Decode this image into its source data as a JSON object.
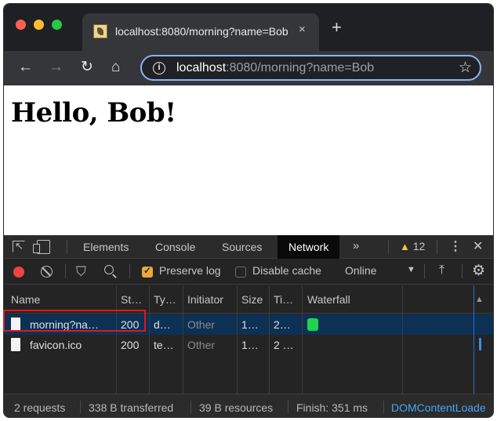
{
  "browser": {
    "tab": {
      "title": "localhost:8080/morning?name=Bob",
      "close_label": "×"
    },
    "new_tab_label": "+",
    "nav": {
      "back": "←",
      "forward": "→",
      "reload": "↻",
      "home": "⌂"
    },
    "url": {
      "host": "localhost",
      "rest": ":8080/morning?name=Bob"
    },
    "icons": {
      "info": "i",
      "star": "☆"
    }
  },
  "page": {
    "heading": "Hello, Bob!"
  },
  "devtools": {
    "tabs": [
      "Elements",
      "Console",
      "Sources",
      "Network"
    ],
    "active_tab": "Network",
    "more_tabs": "»",
    "warnings": {
      "icon": "▲",
      "count": "12"
    },
    "kebab": "⋮",
    "close": "✕",
    "network_toolbar": {
      "filter_icon": "⛉",
      "preserve_log": {
        "label": "Preserve log",
        "checked": true
      },
      "disable_cache": {
        "label": "Disable cache",
        "checked": false
      },
      "throttling": "Online",
      "caret": "▼",
      "import_icon": "⤒",
      "settings_icon": "⚙"
    },
    "columns": [
      "Name",
      "St…",
      "Ty…",
      "Initiator",
      "Size",
      "Ti…",
      "Waterfall"
    ],
    "sort_icon": "▲",
    "rows": [
      {
        "name": "morning?na…",
        "status": "200",
        "type": "d…",
        "initiator": "Other",
        "size": "1…",
        "time": "2…"
      },
      {
        "name": "favicon.ico",
        "status": "200",
        "type": "te…",
        "initiator": "Other",
        "size": "1…",
        "time": "2 …"
      }
    ],
    "status": {
      "requests": "2 requests",
      "transferred": "338 B transferred",
      "resources": "39 B resources",
      "finish": "Finish: 351 ms",
      "dcl": "DOMContentLoade"
    },
    "colors": {
      "accent": "#8ab4f8",
      "selected_row": "#0c3155",
      "highlight": "#e3161b",
      "record": "#ee4444"
    }
  }
}
